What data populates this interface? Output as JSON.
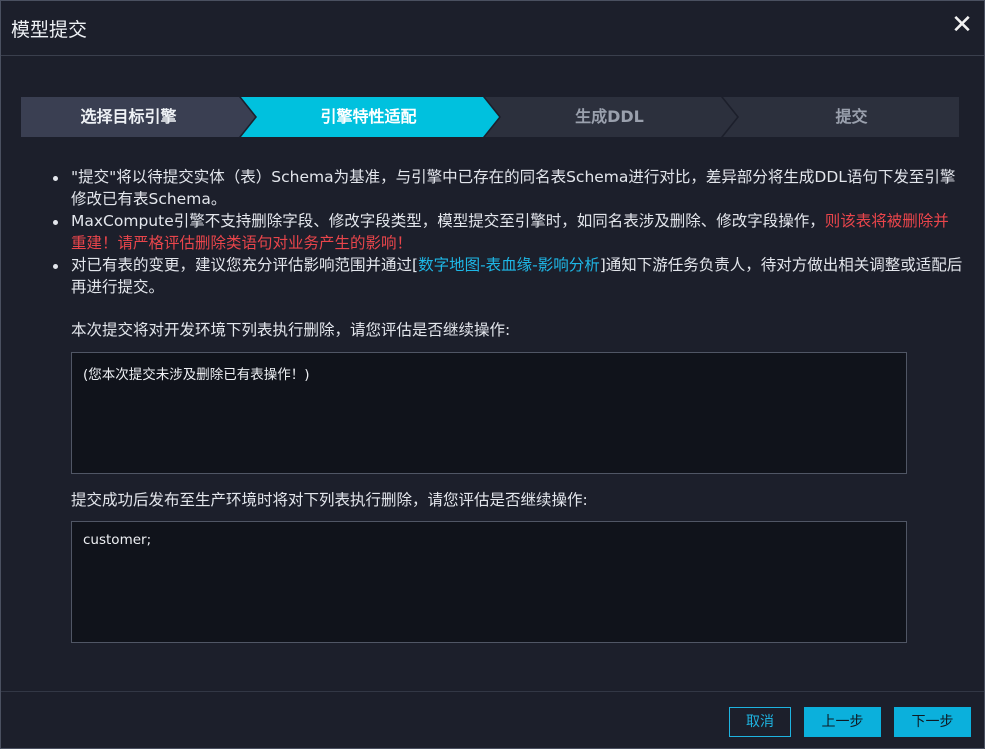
{
  "dialog": {
    "title": "模型提交",
    "close_icon": "close-icon"
  },
  "steps": [
    {
      "label": "选择目标引擎",
      "state": "done"
    },
    {
      "label": "引擎特性适配",
      "state": "active"
    },
    {
      "label": "生成DDL",
      "state": "pending"
    },
    {
      "label": "提交",
      "state": "pending"
    }
  ],
  "colors": {
    "accent": "#00c1de",
    "warning": "#e8454b",
    "link": "#1eb7e6",
    "step_done": "#3a3f52",
    "step_pending": "#2c303d"
  },
  "notes": {
    "n1": "\"提交\"将以待提交实体（表）Schema为基准，与引擎中已存在的同名表Schema进行对比，差异部分将生成DDL语句下发至引擎修改已有表Schema。",
    "n2_text": "MaxCompute引擎不支持删除字段、修改字段类型，模型提交至引擎时，如同名表涉及删除、修改字段操作，",
    "n2_warning": "则该表将被删除并重建！请严格评估删除类语句对业务产生的影响！",
    "n3_before": "对已有表的变更，建议您充分评估影响范围并通过[",
    "n3_link": "数字地图-表血缘-影响分析",
    "n3_after": "]通知下游任务负责人，待对方做出相关调整或适配后再进行提交。"
  },
  "dev_section": {
    "label": "本次提交将对开发环境下列表执行删除，请您评估是否继续操作:",
    "content": "(您本次提交未涉及删除已有表操作！)"
  },
  "prod_section": {
    "label": "提交成功后发布至生产环境时将对下列表执行删除，请您评估是否继续操作:",
    "content": "customer;"
  },
  "footer": {
    "cancel_label": "取消",
    "prev_label": "上一步",
    "next_label": "下一步"
  }
}
